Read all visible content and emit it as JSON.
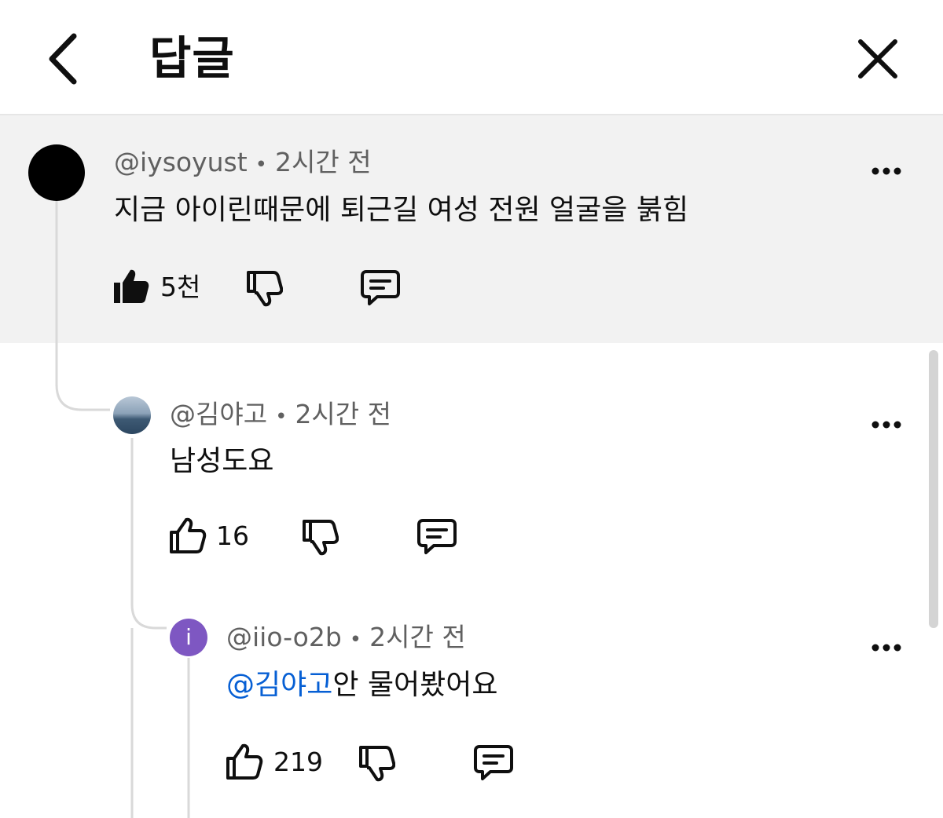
{
  "header": {
    "title": "답글",
    "back_icon": "chevron-left-icon",
    "close_icon": "close-icon"
  },
  "comments": [
    {
      "handle": "@iysoyust",
      "time": "2시간 전",
      "text": "지금 아이린때문에 퇴근길 여성 전원 얼굴을 붉힘",
      "likes": "5천",
      "liked": true
    },
    {
      "handle": "@김야고",
      "time": "2시간 전",
      "text": "남성도요",
      "likes": "16",
      "liked": false
    },
    {
      "handle": "@iio-o2b",
      "time": "2시간 전",
      "avatar_letter": "i",
      "mention": "@김야고",
      "text": "안 물어봤어요",
      "likes": "219",
      "liked": false
    }
  ],
  "meta_separator": "•",
  "colors": {
    "mention": "#065fd4",
    "avatar_purple": "#7e57c2",
    "highlight_bg": "#f2f2f2",
    "meta_text": "#606060"
  }
}
